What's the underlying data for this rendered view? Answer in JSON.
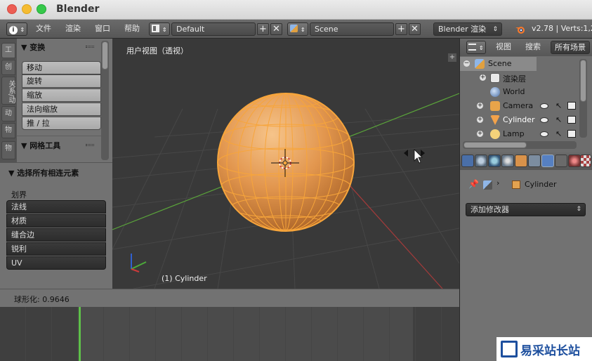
{
  "window": {
    "title": "Blender"
  },
  "header": {
    "menus": [
      "文件",
      "渲染",
      "窗口",
      "帮助"
    ],
    "screen_layout": "Default",
    "scene": "Scene",
    "render_engine": "Blender 渲染",
    "stats": "v2.78 | Verts:1,2"
  },
  "toolshelf": {
    "tabs": [
      "工",
      "创",
      "关系/动",
      "动",
      "物",
      "物"
    ],
    "transform_header": "▼ 变换",
    "transform_buttons": [
      "移动",
      "旋转",
      "缩放",
      "法向缩放",
      "推 / 拉"
    ],
    "mesh_tools_header": "▼ 网格工具"
  },
  "operator": {
    "header": "▼ 选择所有相连元素",
    "section_label": "划界",
    "options": [
      "法线",
      "材质",
      "缝合边",
      "锐利",
      "UV"
    ]
  },
  "viewport": {
    "label": "用户视图（透视）",
    "object_label": "(1) Cylinder"
  },
  "status": {
    "text": "球形化: 0.9646"
  },
  "outliner": {
    "tabs": [
      "视图",
      "搜索",
      "所有场景"
    ],
    "items": [
      {
        "label": "Scene"
      },
      {
        "label": "渲染层"
      },
      {
        "label": "World"
      },
      {
        "label": "Camera"
      },
      {
        "label": "Cylinder"
      },
      {
        "label": "Lamp"
      }
    ]
  },
  "properties": {
    "object_name": "Cylinder",
    "add_modifier": "添加修改器"
  },
  "watermark": {
    "text": "易采站长站"
  },
  "colors": {
    "accent": "#5680c2",
    "selection": "#f39d28",
    "x_axis": "#c84a4a",
    "y_axis": "#6bb33a"
  }
}
